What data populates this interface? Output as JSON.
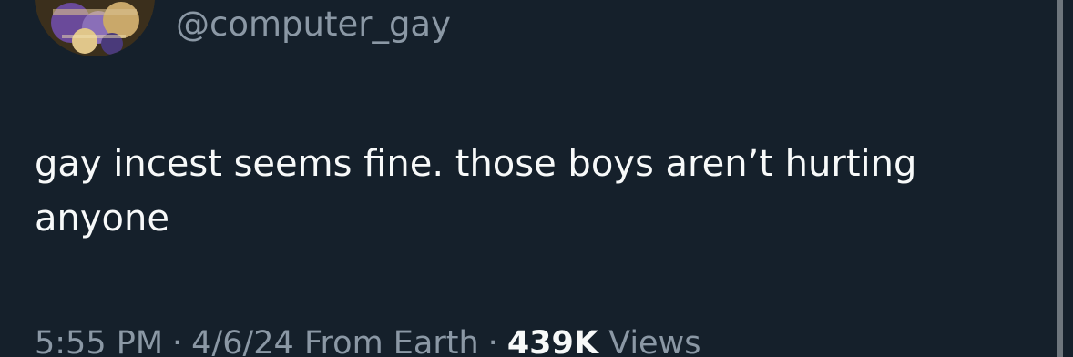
{
  "tweet": {
    "handle": "@computer_gay",
    "text": "gay incest seems fine. those boys aren’t hurting anyone",
    "time": "5:55 PM",
    "separator": "·",
    "date": "4/6/24",
    "source": "From Earth",
    "views_count": "439K",
    "views_label": "Views"
  },
  "colors": {
    "background": "#15202b",
    "primary_text": "#f7f9f9",
    "secondary_text": "#8b98a5"
  }
}
